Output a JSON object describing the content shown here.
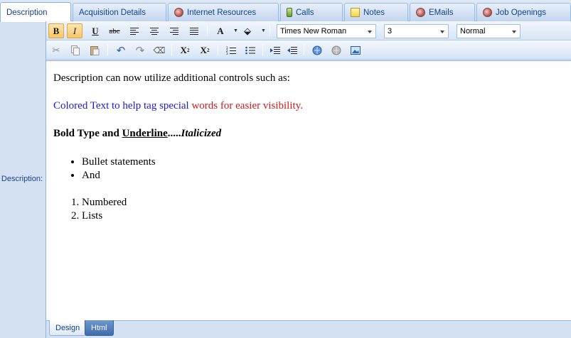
{
  "tabs": [
    {
      "label": "Description",
      "icon": "",
      "active": true
    },
    {
      "label": "Acquisition Details",
      "icon": ""
    },
    {
      "label": "Internet Resources",
      "icon": "globe-icon"
    },
    {
      "label": "Calls",
      "icon": "phone-icon"
    },
    {
      "label": "Notes",
      "icon": "note-icon"
    },
    {
      "label": "EMails",
      "icon": "globe-icon"
    },
    {
      "label": "Job Openings",
      "icon": "globe-icon"
    }
  ],
  "field_label": "Description:",
  "toolbar": {
    "bold": "B",
    "italic": "I",
    "underline": "U",
    "strike": "abc",
    "font_color": "A",
    "font_name": "Times New Roman",
    "font_size": "3",
    "paragraph_style": "Normal",
    "subscript": "X",
    "subscript_mark": "2",
    "superscript": "X",
    "superscript_mark": "2"
  },
  "content": {
    "line1": "Description can now utilize additional controls such as:",
    "colored_blue": "Colored Text to help tag special ",
    "colored_red": "words for easier visibility.",
    "bold_part": "Bold Type and ",
    "underline_part": "Underline",
    "dots": ".....",
    "italic_part": "Italicized",
    "bullets": [
      "Bullet statements",
      "And"
    ],
    "numbered": [
      "Numbered",
      "Lists"
    ]
  },
  "modes": {
    "design": "Design",
    "html": "Html"
  },
  "colors": {
    "accent": "#15428b",
    "blue_text": "#1a1ad8",
    "red_text": "#d21a1a",
    "active_button": "#f7c66a"
  }
}
